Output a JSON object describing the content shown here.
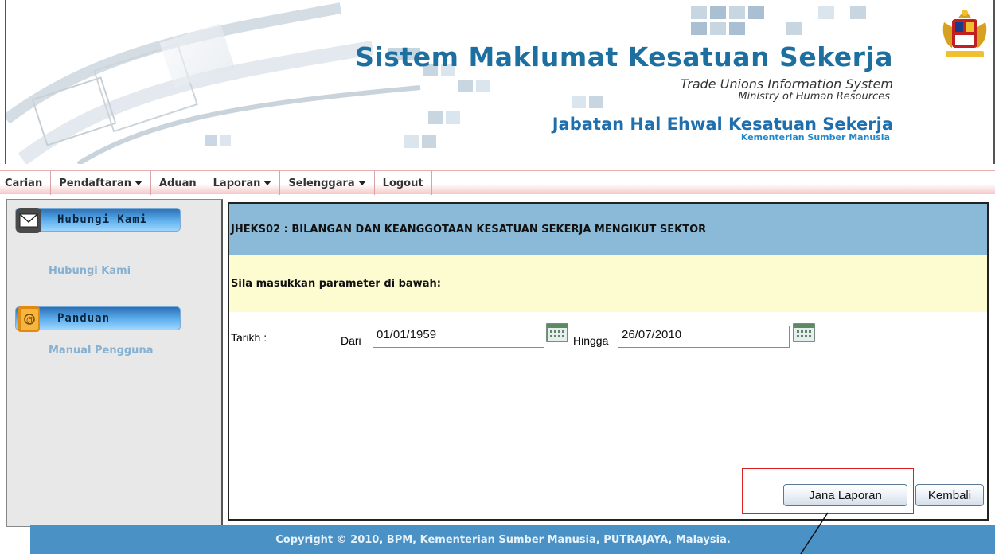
{
  "header": {
    "app_title": "Sistem Maklumat Kesatuan Sekerja",
    "app_subtitle_en": "Trade Unions Information System",
    "app_subtitle_ministry": "Ministry of Human Resources",
    "department": "Jabatan Hal Ehwal Kesatuan Sekerja",
    "department_ministry": "Kementerian Sumber Manusia",
    "logo_icon": "coat-of-arms-icon"
  },
  "menu": {
    "items": [
      {
        "label": "Carian",
        "has_dropdown": false
      },
      {
        "label": "Pendaftaran",
        "has_dropdown": true
      },
      {
        "label": "Aduan",
        "has_dropdown": false
      },
      {
        "label": "Laporan",
        "has_dropdown": true
      },
      {
        "label": "Selenggara",
        "has_dropdown": true
      },
      {
        "label": "Logout",
        "has_dropdown": false
      }
    ]
  },
  "sidebar": {
    "hubungi_button": "Hubungi Kami",
    "hubungi_link": "Hubungi Kami",
    "panduan_button": "Panduan",
    "manual_link": "Manual Pengguna",
    "hubungi_icon": "envelope-icon",
    "panduan_icon": "address-book-icon"
  },
  "main": {
    "report_title": "JHEKS02 : BILANGAN DAN KEANGGOTAAN KESATUAN SEKERJA MENGIKUT SEKTOR",
    "param_prompt": "Sila masukkan parameter di bawah:",
    "tarikh_label": "Tarikh :",
    "dari_label": "Dari",
    "dari_value": "01/01/1959",
    "hingga_label": "Hingga",
    "hingga_value": "26/07/2010",
    "calendar_icon": "calendar-icon",
    "generate_button": "Jana Laporan",
    "back_button": "Kembali"
  },
  "footer": {
    "copyright": "Copyright © 2010, BPM, Kementerian Sumber Manusia, PUTRAJAYA, Malaysia."
  },
  "colors": {
    "title_blue": "#1d6fa0",
    "header_band": "#8bbad8",
    "param_band": "#fdfbd0",
    "footer": "#4a91c6",
    "highlight": "#e02020"
  }
}
